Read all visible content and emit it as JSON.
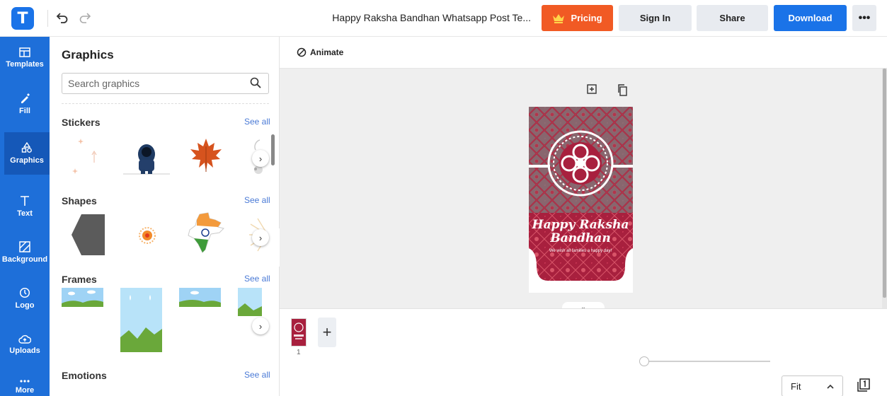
{
  "app": {
    "logo_letter": "T",
    "doc_title": "Happy Raksha Bandhan Whatsapp Post Te...",
    "buttons": {
      "pricing": "Pricing",
      "sign_in": "Sign In",
      "share": "Share",
      "download": "Download",
      "more": "•••"
    }
  },
  "rail": [
    {
      "label": "Templates",
      "icon": "templates-icon"
    },
    {
      "label": "Fill",
      "icon": "fill-icon"
    },
    {
      "label": "Graphics",
      "icon": "graphics-icon",
      "active": true
    },
    {
      "label": "Text",
      "icon": "text-icon"
    },
    {
      "label": "Background",
      "icon": "background-icon"
    },
    {
      "label": "Logo",
      "icon": "logo-icon"
    },
    {
      "label": "Uploads",
      "icon": "uploads-icon"
    },
    {
      "label": "More",
      "icon": "more-icon"
    }
  ],
  "panel": {
    "title": "Graphics",
    "search_placeholder": "Search graphics",
    "sections": [
      {
        "title": "Stickers",
        "see_all": "See all"
      },
      {
        "title": "Shapes",
        "see_all": "See all"
      },
      {
        "title": "Frames",
        "see_all": "See all"
      },
      {
        "title": "Emotions",
        "see_all": "See all"
      }
    ]
  },
  "editor": {
    "animate_label": "Animate",
    "design": {
      "headline_1": "Happy Raksha",
      "headline_2": "Bandhan",
      "subtext": "We wish all families a happy day!"
    },
    "page_number": "1",
    "add_page": "+",
    "zoom_value": "Fit"
  },
  "colors": {
    "brand_blue": "#1a73e8",
    "rail_blue": "#1e6fd9",
    "pricing_orange": "#f15a24",
    "design_red": "#a8203e",
    "design_grey": "#7e7e7e"
  }
}
